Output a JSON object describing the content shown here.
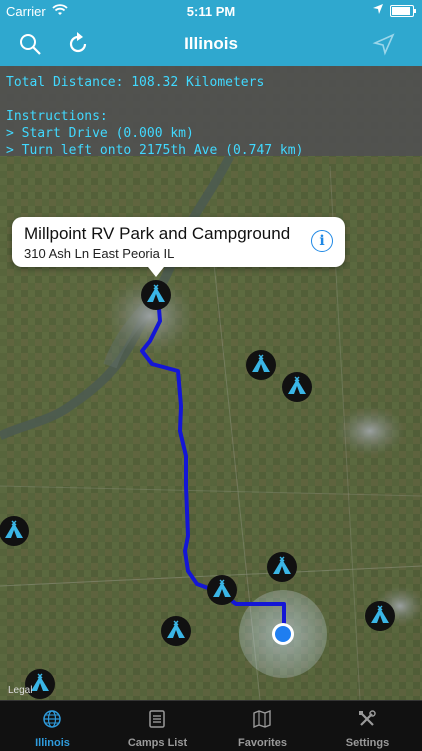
{
  "status_bar": {
    "carrier": "Carrier",
    "time": "5:11 PM",
    "battery_level": 0.95
  },
  "nav_bar": {
    "title": "Illinois",
    "left_icon": "search-icon",
    "refresh_icon": "refresh-icon",
    "right_icon": "location-arrow-icon"
  },
  "directions": {
    "total_distance": "Total Distance: 108.32 Kilometers",
    "instructions_heading": "Instructions:",
    "steps": [
      "> Start Drive (0.000 km)",
      "> Turn left onto 2175th Ave (0.747 km)"
    ]
  },
  "callout": {
    "name": "Millpoint RV Park and Campground",
    "address": "310 Ash Ln East Peoria IL"
  },
  "map": {
    "legal": "Legal",
    "route_color": "#1416d6",
    "marker_icon": "campground-tent-icon",
    "marker_color": "#3ab6e6",
    "user_location_color": "#1f7ef0"
  },
  "tabs": [
    {
      "label": "Illinois",
      "icon": "globe-icon",
      "active": true
    },
    {
      "label": "Camps List",
      "icon": "list-icon",
      "active": false
    },
    {
      "label": "Favorites",
      "icon": "map-book-icon",
      "active": false
    },
    {
      "label": "Settings",
      "icon": "tools-icon",
      "active": false
    }
  ],
  "colors": {
    "accent": "#2fa8cf",
    "directions_text": "#41d9ff",
    "tab_active": "#2f9bdc"
  }
}
